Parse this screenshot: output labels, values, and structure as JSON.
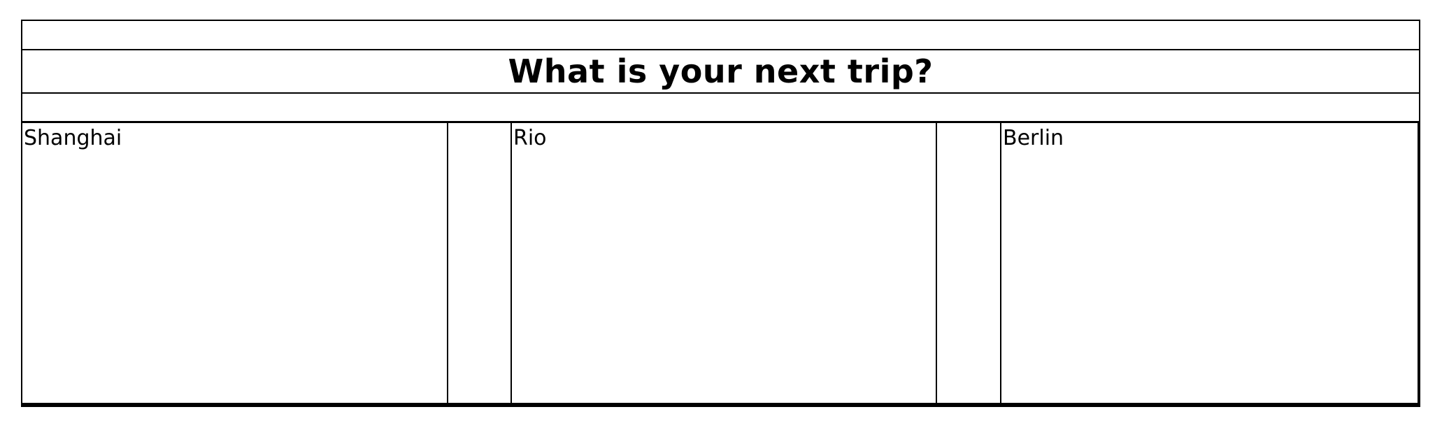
{
  "page": {
    "title": "What is your next trip?"
  },
  "destinations": [
    {
      "label": "Shanghai"
    },
    {
      "label": "Rio"
    },
    {
      "label": "Berlin"
    }
  ]
}
